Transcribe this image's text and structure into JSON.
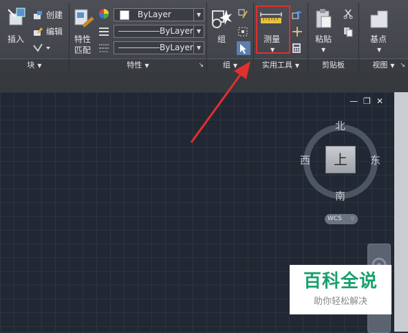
{
  "ribbon": {
    "block": {
      "insert_label": "插入",
      "create_label": "创建",
      "edit_label": "编辑",
      "panel_label": "块"
    },
    "properties": {
      "match_label_1": "特性",
      "match_label_2": "匹配",
      "color_value": "ByLayer",
      "linetype_value": "ByLayer",
      "lineweight_value": "ByLayer",
      "panel_label": "特性"
    },
    "group": {
      "group_label": "组",
      "panel_label": "组"
    },
    "utilities": {
      "measure_label": "测量",
      "panel_label": "实用工具"
    },
    "clipboard": {
      "paste_label": "粘贴",
      "panel_label": "剪贴板"
    },
    "view": {
      "base_label": "基点",
      "panel_label": "视图"
    }
  },
  "viewport": {
    "minimize": "—",
    "restore": "❐",
    "close": "✕"
  },
  "viewcube": {
    "north": "北",
    "south": "南",
    "east": "东",
    "west": "西",
    "face": "上",
    "wcs_label": "WCS"
  },
  "watermark": {
    "title": "百科全说",
    "subtitle": "助你轻松解决"
  },
  "colors": {
    "highlight": "#e03030",
    "watermark_green": "#18a06b"
  }
}
